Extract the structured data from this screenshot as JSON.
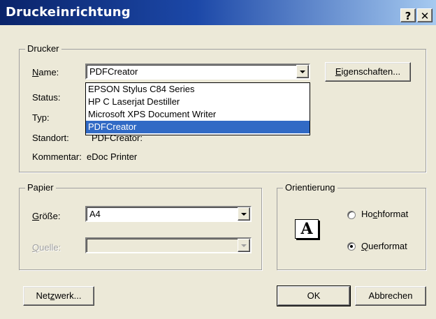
{
  "window": {
    "title": "Druckeinrichtung",
    "help_label": "?",
    "close_label": "✕"
  },
  "printer": {
    "group_label": "Drucker",
    "name_label": "Name:",
    "selected": "PDFCreator",
    "properties_button": "Eigenschaften...",
    "status_label": "Status:",
    "type_label": "Typ:",
    "location_label": "Standort:",
    "location_value": "PDFCreator:",
    "comment_label": "Kommentar:",
    "comment_value": "eDoc Printer",
    "options": [
      "EPSON Stylus C84 Series",
      "HP C Laserjat Destiller",
      "Microsoft XPS Document Writer",
      "PDFCreator"
    ],
    "highlighted_index": 3
  },
  "paper": {
    "group_label": "Papier",
    "size_label": "Größe:",
    "size_value": "A4",
    "source_label": "Quelle:",
    "source_value": ""
  },
  "orientation": {
    "group_label": "Orientierung",
    "icon_letter": "A",
    "portrait_label": "Hochformat",
    "landscape_label": "Querformat",
    "selected": "landscape"
  },
  "buttons": {
    "network": "Netzwerk...",
    "ok": "OK",
    "cancel": "Abbrechen"
  }
}
